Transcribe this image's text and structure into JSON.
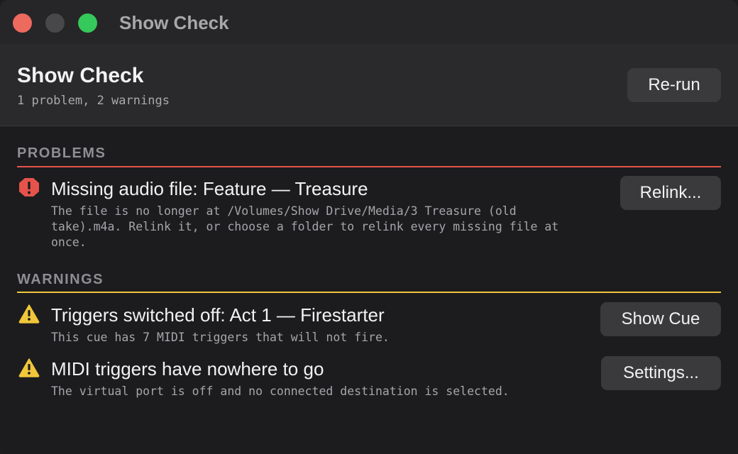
{
  "window": {
    "title": "Show Check"
  },
  "header": {
    "title": "Show Check",
    "summary": "1 problem, 2 warnings",
    "rerun_label": "Re-run"
  },
  "sections": {
    "problems_label": "PROBLEMS",
    "warnings_label": "WARNINGS"
  },
  "problems": [
    {
      "icon": "error-octagon-icon",
      "title": "Missing audio file: Feature — Treasure",
      "description": "The file is no longer at /Volumes/Show Drive/Media/3 Treasure (old take).m4a. Relink it, or choose a folder to relink every missing file at once.",
      "action_label": "Relink..."
    }
  ],
  "warnings": [
    {
      "icon": "warning-triangle-icon",
      "title": "Triggers switched off: Act 1 — Firestarter",
      "description": "This cue has 7 MIDI triggers that will not fire.",
      "action_label": "Show Cue"
    },
    {
      "icon": "warning-triangle-icon",
      "title": "MIDI triggers have nowhere to go",
      "description": "The virtual port is off and no connected destination is selected.",
      "action_label": "Settings..."
    }
  ],
  "colors": {
    "problem_accent": "#e5534b",
    "warning_accent": "#f0c63a",
    "background": "#1c1c1e"
  }
}
